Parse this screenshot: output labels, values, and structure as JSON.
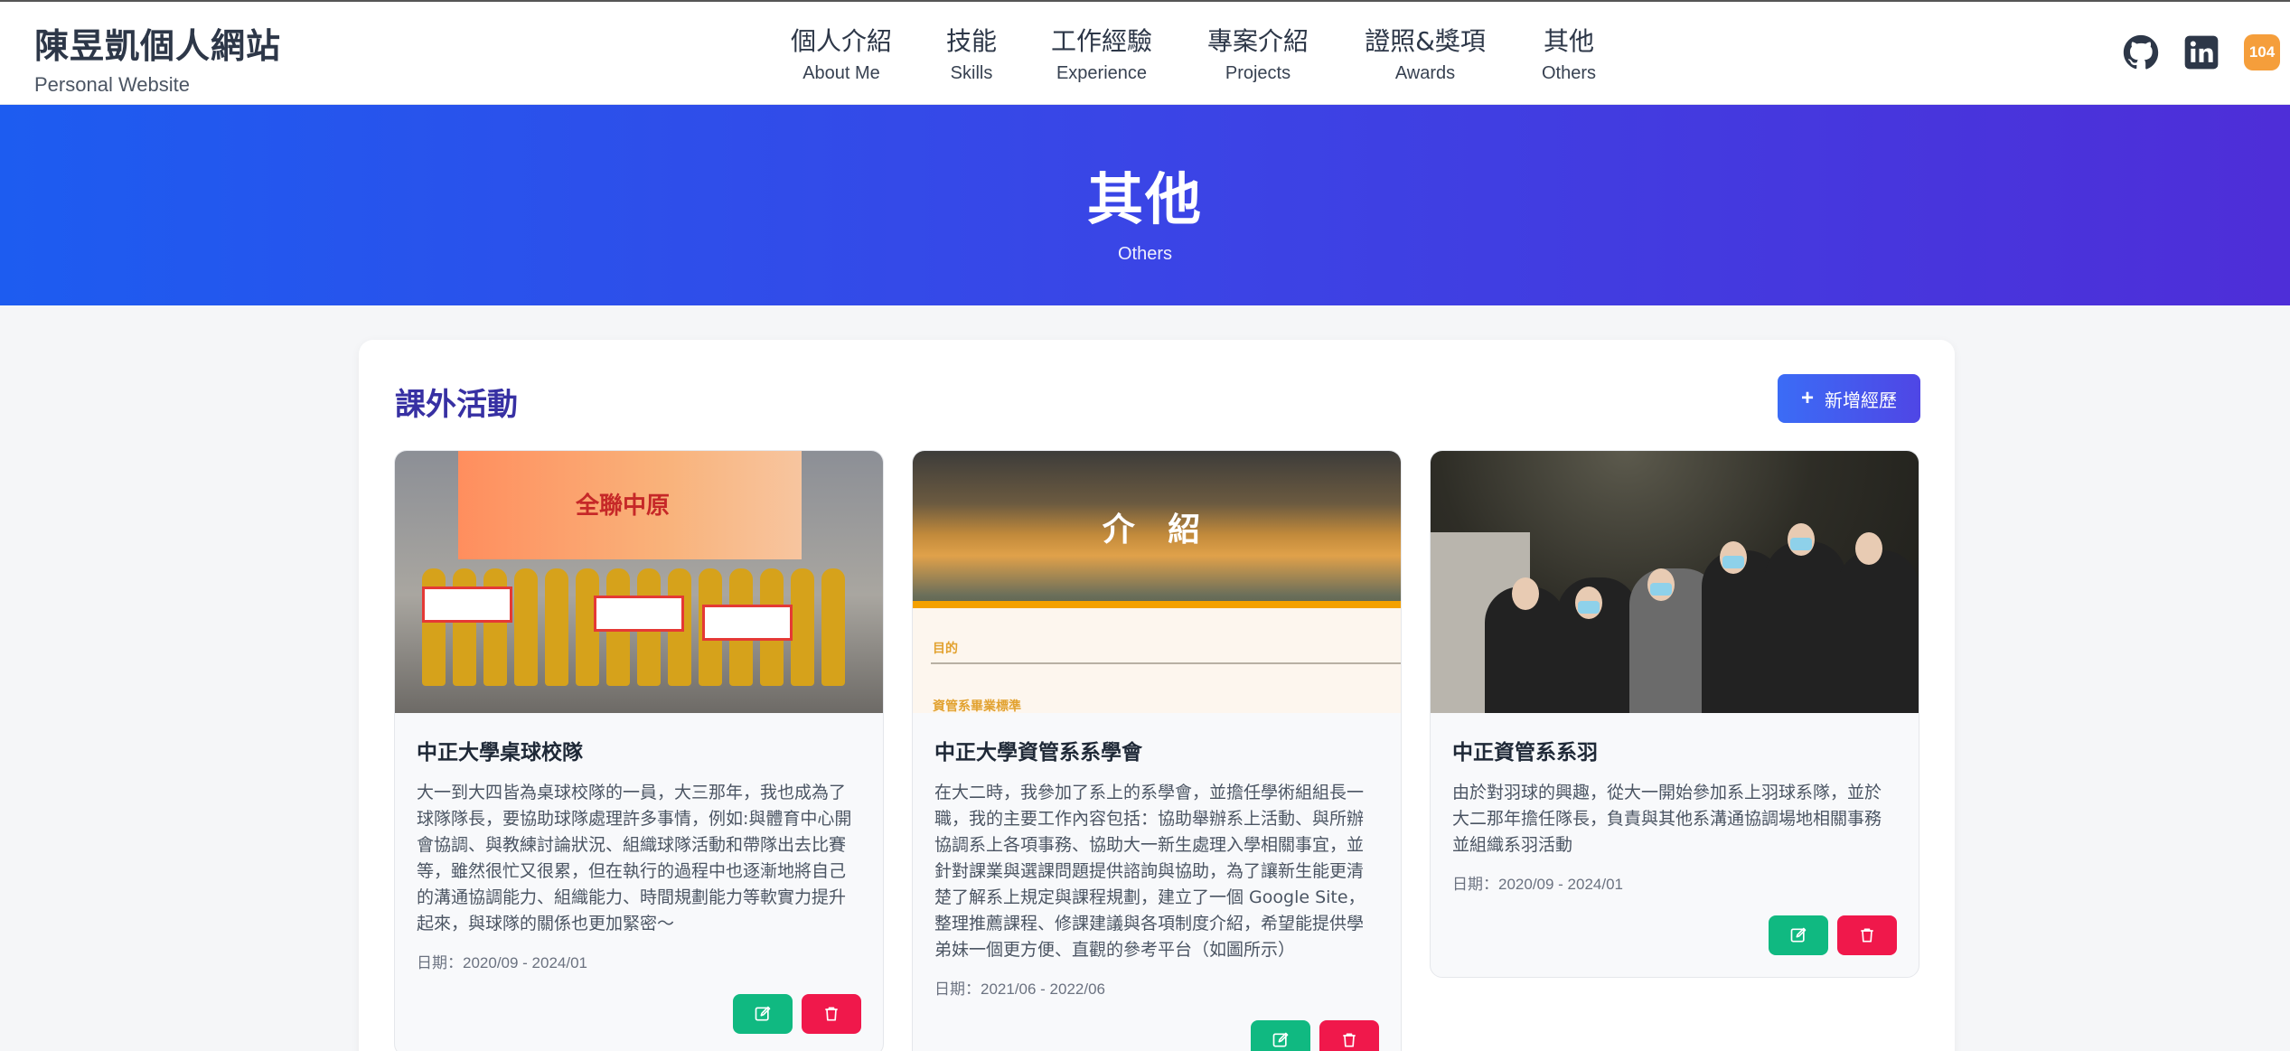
{
  "header": {
    "title": "陳昱凱個人網站",
    "subtitle": "Personal Website",
    "nav": [
      {
        "zh": "個人介紹",
        "en": "About Me"
      },
      {
        "zh": "技能",
        "en": "Skills"
      },
      {
        "zh": "工作經驗",
        "en": "Experience"
      },
      {
        "zh": "專案介紹",
        "en": "Projects"
      },
      {
        "zh": "證照&獎項",
        "en": "Awards"
      },
      {
        "zh": "其他",
        "en": "Others"
      }
    ],
    "social": {
      "github": "github-icon",
      "linkedin": "linkedin-icon",
      "badge_104": "104"
    }
  },
  "hero": {
    "title": "其他",
    "subtitle": "Others"
  },
  "section": {
    "title": "課外活動",
    "add_label": "新增經歷"
  },
  "cards": [
    {
      "title": "中正大學桌球校隊",
      "description": "大一到大四皆為桌球校隊的一員，大三那年，我也成為了球隊隊長，要協助球隊處理許多事情，例如:與體育中心開會協調、與教練討論狀況、組織球隊活動和帶隊出去比賽等，雖然很忙又很累，但在執行的過程中也逐漸地將自己的溝通協調能力、組織能力、時間規劃能力等軟實力提升起來，與球隊的關係也更加緊密～",
      "date": "日期：2020/09 - 2024/01",
      "image_text": "全聯中原",
      "sign_texts": [
        "",
        "",
        ""
      ]
    },
    {
      "title": "中正大學資管系系學會",
      "description": "在大二時，我參加了系上的系學會，並擔任學術組組長一職，我的主要工作內容包括：協助舉辦系上活動、與所辦協調系上各項事務、協助大一新生處理入學相關事宜，並針對課業與選課問題提供諮詢與協助，為了讓新生能更清楚了解系上規定與課程規劃，建立了一個 Google Site，整理推薦課程、修課建議與各項制度介紹，希望能提供學弟妹一個更方便、直觀的參考平台（如圖所示）",
      "date": "日期：2021/06 - 2022/06",
      "image_text": "介 紹",
      "image_labels": [
        "目的",
        "資管系畢業標準"
      ]
    },
    {
      "title": "中正資管系系羽",
      "description": "由於對羽球的興趣，從大一開始參加系上羽球系隊，並於大二那年擔任隊長，負責與其他系溝通協調場地相關事務並組織系羽活動",
      "date": "日期：2020/09 - 2024/01"
    }
  ],
  "colors": {
    "brand_title": "#3730a3",
    "edit": "#10b981",
    "delete": "#f0184b",
    "hero_start": "#1d5cf0",
    "hero_end": "#4e2ed8"
  }
}
